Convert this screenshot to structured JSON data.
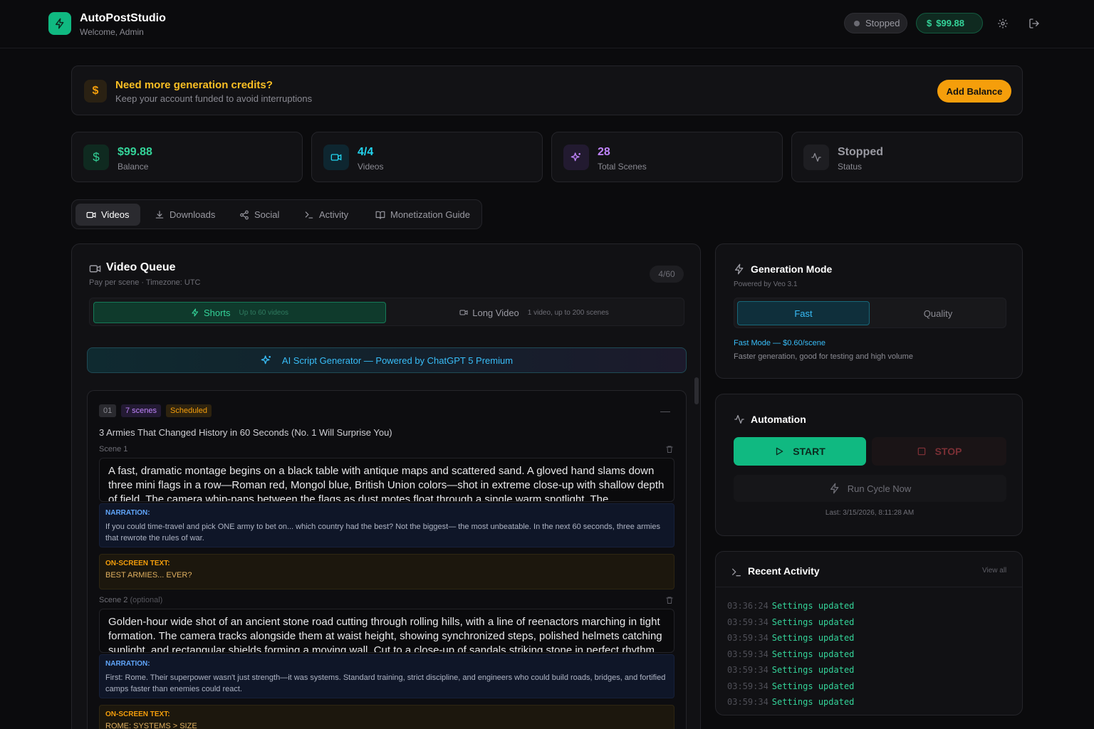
{
  "header": {
    "app_name": "AutoPostStudio",
    "welcome": "Welcome, Admin",
    "status_pill": "Stopped",
    "balance_pill": "$99.88",
    "balance_symbol": "$"
  },
  "banner": {
    "symbol": "$",
    "title": "Need more generation credits?",
    "subtitle": "Keep your account funded to avoid interruptions",
    "button": "Add Balance"
  },
  "stats": [
    {
      "value": "$99.88",
      "label": "Balance",
      "icon": "dollar-icon",
      "color": "#34d399"
    },
    {
      "value": "4/4",
      "label": "Videos",
      "icon": "video-icon",
      "color": "#22d3ee"
    },
    {
      "value": "28",
      "label": "Total Scenes",
      "icon": "sparkles-icon",
      "color": "#c084fc"
    },
    {
      "value": "Stopped",
      "label": "Status",
      "icon": "activity-icon",
      "color": "#9a9aa2"
    }
  ],
  "tabs": [
    {
      "label": "Videos",
      "active": true
    },
    {
      "label": "Downloads"
    },
    {
      "label": "Social"
    },
    {
      "label": "Activity"
    },
    {
      "label": "Monetization Guide"
    }
  ],
  "queue": {
    "title": "Video Queue",
    "subtitle": "Pay per scene · Timezone: UTC",
    "count": "4/60",
    "shorts_label": "Shorts",
    "shorts_hint": "Up to 60 videos",
    "long_label": "Long Video",
    "long_hint": "1 video, up to 200 scenes",
    "ai_generator": "AI Script Generator — Powered by ChatGPT 5 Premium",
    "item": {
      "number": "01",
      "scenes_badge": "7 scenes",
      "status_badge": "Scheduled",
      "title": "3 Armies That Changed History in 60 Seconds (No. 1 Will Surprise You)",
      "scenes": [
        {
          "label": "Scene 1",
          "optional": "",
          "prompt": "A fast, dramatic montage begins on a black table with antique maps and scattered sand. A gloved hand slams down three mini flags in a row—Roman red, Mongol blue, British Union colors—shot in extreme close-up with shallow depth of field. The camera whip-pans between the flags as dust motes float through a single warm spotlight. The soundscape",
          "narration_label": "NARRATION:",
          "narration": "If you could time-travel and pick ONE army to bet on... which country had the best? Not the biggest— the most unbeatable. In the next 60 seconds, three armies that rewrote the rules of war.",
          "onscreen_label": "ON-SCREEN TEXT:",
          "onscreen": "BEST ARMIES... EVER?"
        },
        {
          "label": "Scene 2",
          "optional": "(optional)",
          "prompt": "Golden-hour wide shot of an ancient stone road cutting through rolling hills, with a line of reenactors marching in tight formation. The camera tracks alongside them at waist height, showing synchronized steps, polished helmets catching sunlight, and rectangular shields forming a moving wall. Cut to a close-up of sandals striking stone in perfect rhythm.",
          "narration_label": "NARRATION:",
          "narration": "First: Rome. Their superpower wasn't just strength—it was systems. Standard training, strict discipline, and engineers who could build roads, bridges, and fortified camps faster than enemies could react.",
          "onscreen_label": "ON-SCREEN TEXT:",
          "onscreen": "ROME: SYSTEMS > SIZE"
        }
      ]
    }
  },
  "generation": {
    "title": "Generation Mode",
    "subtitle": "Powered by Veo 3.1",
    "fast_label": "Fast",
    "quality_label": "Quality",
    "mode_line": "Fast Mode — $0.60/scene",
    "mode_desc": "Faster generation, good for testing and high volume"
  },
  "automation": {
    "title": "Automation",
    "start": "START",
    "stop": "STOP",
    "run_cycle": "Run Cycle Now",
    "last": "Last: 3/15/2026, 8:11:28 AM"
  },
  "activity": {
    "title": "Recent Activity",
    "view_all": "View all",
    "logs": [
      {
        "time": "03:36:24",
        "msg": "Settings updated"
      },
      {
        "time": "03:59:34",
        "msg": "Settings updated"
      },
      {
        "time": "03:59:34",
        "msg": "Settings updated"
      },
      {
        "time": "03:59:34",
        "msg": "Settings updated"
      },
      {
        "time": "03:59:34",
        "msg": "Settings updated"
      },
      {
        "time": "03:59:34",
        "msg": "Settings updated"
      },
      {
        "time": "03:59:34",
        "msg": "Settings updated"
      }
    ]
  },
  "colors": {
    "accent_green": "#10b981",
    "accent_amber": "#f59e0b",
    "accent_cyan": "#38bdf8",
    "background": "#0b0b0d"
  }
}
